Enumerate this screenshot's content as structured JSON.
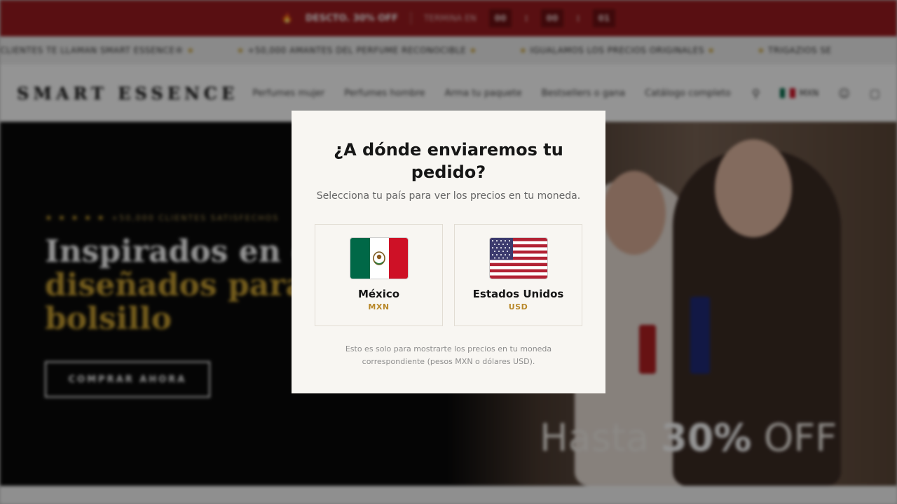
{
  "promo": {
    "discount_text": "DESCTO. 30% OFF",
    "timer_label": "TERMINA EN",
    "timer": [
      "00",
      "00",
      "01"
    ]
  },
  "marquee": {
    "items": [
      "CLIENTES TE LLAMAN SMART ESSENCE®",
      "+50,000 AMANTES DEL PERFUME RECONOCIBLE",
      "IGUALAMOS LOS PRECIOS ORIGINALES",
      "TRIGAZIOS SE"
    ]
  },
  "header": {
    "logo": "SMART ESSENCE",
    "nav": [
      "Perfumes mujer",
      "Perfumes hombre",
      "Arma tu paquete",
      "Bestsellers o gana",
      "Catálogo completo"
    ],
    "language": "MXN"
  },
  "hero": {
    "rating_stars": "★ ★ ★ ★ ★",
    "rating_text": "+50,000 CLIENTES SATISFECHOS",
    "title_line1": "Inspirados en el l",
    "title_line2": "diseñados para tu",
    "title_line3": "bolsillo",
    "cta": "COMPRAR AHORA",
    "offer_prefix": "Hasta",
    "offer_value": "30%",
    "offer_suffix": "OFF"
  },
  "modal": {
    "title": "¿A dónde enviaremos tu pedido?",
    "subtitle": "Selecciona tu país para ver los precios en tu moneda.",
    "countries": [
      {
        "name": "México",
        "currency": "MXN",
        "flag_icon": "mexico-flag-icon"
      },
      {
        "name": "Estados Unidos",
        "currency": "USD",
        "flag_icon": "usa-flag-icon"
      }
    ],
    "note": "Esto es solo para mostrarte los precios en tu moneda correspondiente (pesos MXN o dólares USD)."
  },
  "colors": {
    "promo_bar": "#9a1b1f",
    "gold_accent": "#c9a032",
    "currency_label": "#b8882a",
    "modal_bg": "#f8f6f2"
  }
}
